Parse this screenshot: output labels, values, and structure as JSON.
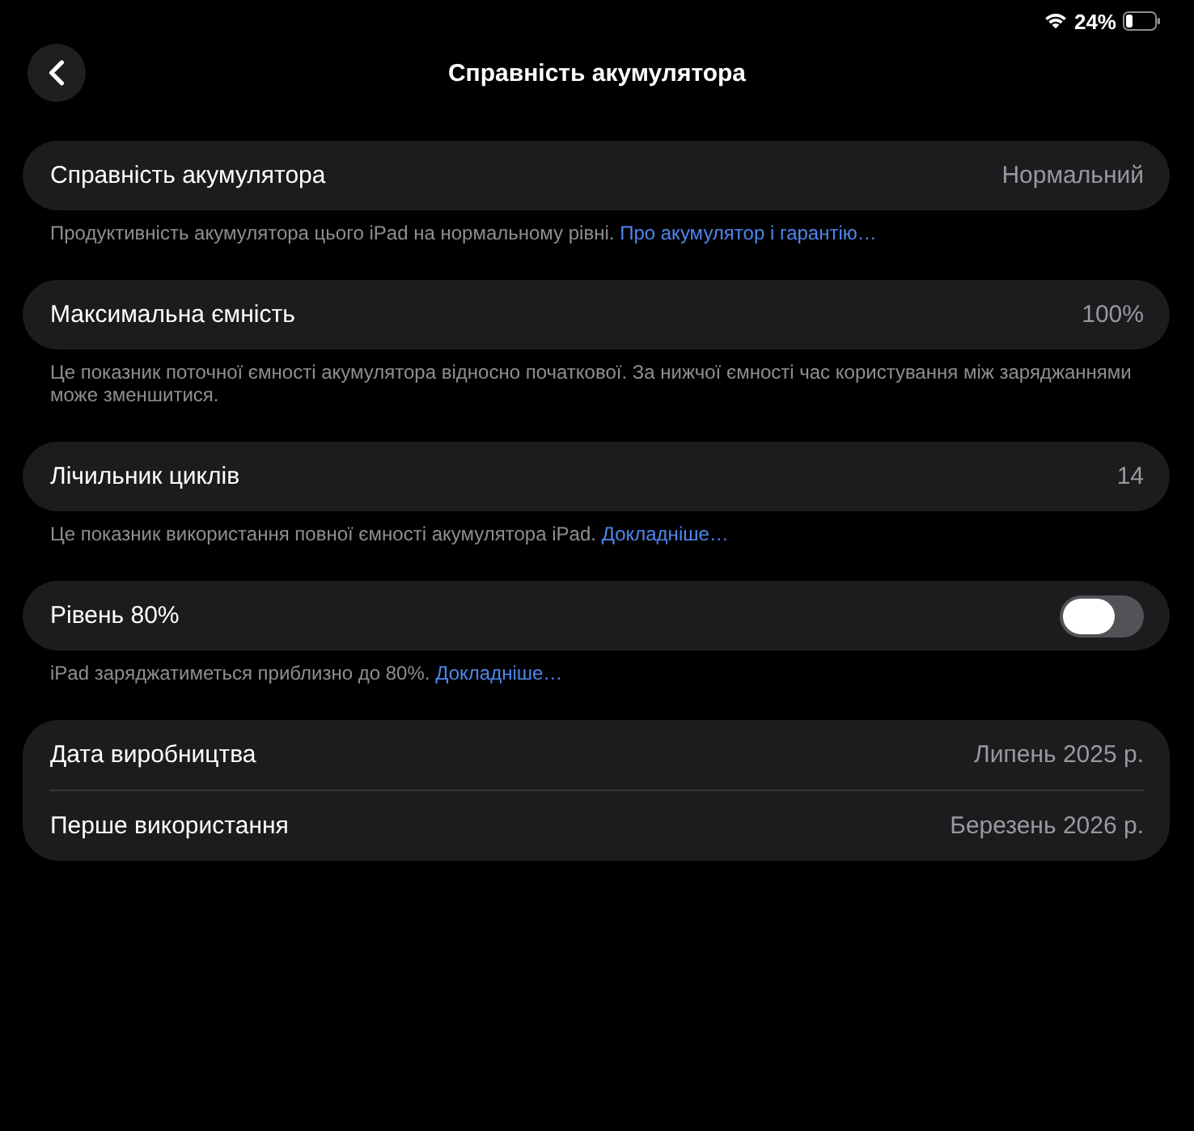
{
  "status_bar": {
    "battery_text": "24%"
  },
  "nav": {
    "title": "Справність акумулятора"
  },
  "sections": [
    {
      "rows": [
        {
          "kind": "value",
          "label": "Справність акумулятора",
          "value": "Нормальний"
        }
      ],
      "footer": {
        "text": "Продуктивність акумулятора цього iPad на нормальному рівні.",
        "link": "Про акумулятор і гарантію…"
      }
    },
    {
      "rows": [
        {
          "kind": "value",
          "label": "Максимальна ємність",
          "value": "100%"
        }
      ],
      "footer": {
        "text": "Це показник поточної ємності акумулятора відносно початкової. За нижчої ємності час користування між заряджаннями може зменшитися."
      }
    },
    {
      "rows": [
        {
          "kind": "value",
          "label": "Лічильник циклів",
          "value": "14"
        }
      ],
      "footer": {
        "text": "Це показник використання повної ємності акумулятора iPad.",
        "link": "Докладніше…"
      }
    },
    {
      "rows": [
        {
          "kind": "toggle",
          "label": "Рівень 80%",
          "on": false
        }
      ],
      "footer": {
        "text": "iPad заряджатиметься приблизно до 80%.",
        "link": "Докладніше…"
      }
    },
    {
      "rows": [
        {
          "kind": "value",
          "label": "Дата виробництва",
          "value": "Липень 2025 р."
        },
        {
          "kind": "value",
          "label": "Перше використання",
          "value": "Березень 2026 р."
        }
      ]
    }
  ]
}
